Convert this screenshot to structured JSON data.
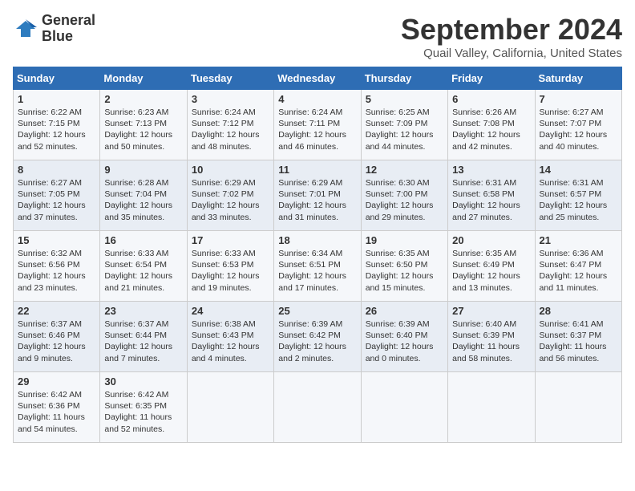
{
  "header": {
    "logo_line1": "General",
    "logo_line2": "Blue",
    "title": "September 2024",
    "subtitle": "Quail Valley, California, United States"
  },
  "weekdays": [
    "Sunday",
    "Monday",
    "Tuesday",
    "Wednesday",
    "Thursday",
    "Friday",
    "Saturday"
  ],
  "weeks": [
    [
      {
        "day": "1",
        "lines": [
          "Sunrise: 6:22 AM",
          "Sunset: 7:15 PM",
          "Daylight: 12 hours",
          "and 52 minutes."
        ]
      },
      {
        "day": "2",
        "lines": [
          "Sunrise: 6:23 AM",
          "Sunset: 7:13 PM",
          "Daylight: 12 hours",
          "and 50 minutes."
        ]
      },
      {
        "day": "3",
        "lines": [
          "Sunrise: 6:24 AM",
          "Sunset: 7:12 PM",
          "Daylight: 12 hours",
          "and 48 minutes."
        ]
      },
      {
        "day": "4",
        "lines": [
          "Sunrise: 6:24 AM",
          "Sunset: 7:11 PM",
          "Daylight: 12 hours",
          "and 46 minutes."
        ]
      },
      {
        "day": "5",
        "lines": [
          "Sunrise: 6:25 AM",
          "Sunset: 7:09 PM",
          "Daylight: 12 hours",
          "and 44 minutes."
        ]
      },
      {
        "day": "6",
        "lines": [
          "Sunrise: 6:26 AM",
          "Sunset: 7:08 PM",
          "Daylight: 12 hours",
          "and 42 minutes."
        ]
      },
      {
        "day": "7",
        "lines": [
          "Sunrise: 6:27 AM",
          "Sunset: 7:07 PM",
          "Daylight: 12 hours",
          "and 40 minutes."
        ]
      }
    ],
    [
      {
        "day": "8",
        "lines": [
          "Sunrise: 6:27 AM",
          "Sunset: 7:05 PM",
          "Daylight: 12 hours",
          "and 37 minutes."
        ]
      },
      {
        "day": "9",
        "lines": [
          "Sunrise: 6:28 AM",
          "Sunset: 7:04 PM",
          "Daylight: 12 hours",
          "and 35 minutes."
        ]
      },
      {
        "day": "10",
        "lines": [
          "Sunrise: 6:29 AM",
          "Sunset: 7:02 PM",
          "Daylight: 12 hours",
          "and 33 minutes."
        ]
      },
      {
        "day": "11",
        "lines": [
          "Sunrise: 6:29 AM",
          "Sunset: 7:01 PM",
          "Daylight: 12 hours",
          "and 31 minutes."
        ]
      },
      {
        "day": "12",
        "lines": [
          "Sunrise: 6:30 AM",
          "Sunset: 7:00 PM",
          "Daylight: 12 hours",
          "and 29 minutes."
        ]
      },
      {
        "day": "13",
        "lines": [
          "Sunrise: 6:31 AM",
          "Sunset: 6:58 PM",
          "Daylight: 12 hours",
          "and 27 minutes."
        ]
      },
      {
        "day": "14",
        "lines": [
          "Sunrise: 6:31 AM",
          "Sunset: 6:57 PM",
          "Daylight: 12 hours",
          "and 25 minutes."
        ]
      }
    ],
    [
      {
        "day": "15",
        "lines": [
          "Sunrise: 6:32 AM",
          "Sunset: 6:56 PM",
          "Daylight: 12 hours",
          "and 23 minutes."
        ]
      },
      {
        "day": "16",
        "lines": [
          "Sunrise: 6:33 AM",
          "Sunset: 6:54 PM",
          "Daylight: 12 hours",
          "and 21 minutes."
        ]
      },
      {
        "day": "17",
        "lines": [
          "Sunrise: 6:33 AM",
          "Sunset: 6:53 PM",
          "Daylight: 12 hours",
          "and 19 minutes."
        ]
      },
      {
        "day": "18",
        "lines": [
          "Sunrise: 6:34 AM",
          "Sunset: 6:51 PM",
          "Daylight: 12 hours",
          "and 17 minutes."
        ]
      },
      {
        "day": "19",
        "lines": [
          "Sunrise: 6:35 AM",
          "Sunset: 6:50 PM",
          "Daylight: 12 hours",
          "and 15 minutes."
        ]
      },
      {
        "day": "20",
        "lines": [
          "Sunrise: 6:35 AM",
          "Sunset: 6:49 PM",
          "Daylight: 12 hours",
          "and 13 minutes."
        ]
      },
      {
        "day": "21",
        "lines": [
          "Sunrise: 6:36 AM",
          "Sunset: 6:47 PM",
          "Daylight: 12 hours",
          "and 11 minutes."
        ]
      }
    ],
    [
      {
        "day": "22",
        "lines": [
          "Sunrise: 6:37 AM",
          "Sunset: 6:46 PM",
          "Daylight: 12 hours",
          "and 9 minutes."
        ]
      },
      {
        "day": "23",
        "lines": [
          "Sunrise: 6:37 AM",
          "Sunset: 6:44 PM",
          "Daylight: 12 hours",
          "and 7 minutes."
        ]
      },
      {
        "day": "24",
        "lines": [
          "Sunrise: 6:38 AM",
          "Sunset: 6:43 PM",
          "Daylight: 12 hours",
          "and 4 minutes."
        ]
      },
      {
        "day": "25",
        "lines": [
          "Sunrise: 6:39 AM",
          "Sunset: 6:42 PM",
          "Daylight: 12 hours",
          "and 2 minutes."
        ]
      },
      {
        "day": "26",
        "lines": [
          "Sunrise: 6:39 AM",
          "Sunset: 6:40 PM",
          "Daylight: 12 hours",
          "and 0 minutes."
        ]
      },
      {
        "day": "27",
        "lines": [
          "Sunrise: 6:40 AM",
          "Sunset: 6:39 PM",
          "Daylight: 11 hours",
          "and 58 minutes."
        ]
      },
      {
        "day": "28",
        "lines": [
          "Sunrise: 6:41 AM",
          "Sunset: 6:37 PM",
          "Daylight: 11 hours",
          "and 56 minutes."
        ]
      }
    ],
    [
      {
        "day": "29",
        "lines": [
          "Sunrise: 6:42 AM",
          "Sunset: 6:36 PM",
          "Daylight: 11 hours",
          "and 54 minutes."
        ]
      },
      {
        "day": "30",
        "lines": [
          "Sunrise: 6:42 AM",
          "Sunset: 6:35 PM",
          "Daylight: 11 hours",
          "and 52 minutes."
        ]
      },
      {
        "day": "",
        "lines": []
      },
      {
        "day": "",
        "lines": []
      },
      {
        "day": "",
        "lines": []
      },
      {
        "day": "",
        "lines": []
      },
      {
        "day": "",
        "lines": []
      }
    ]
  ]
}
